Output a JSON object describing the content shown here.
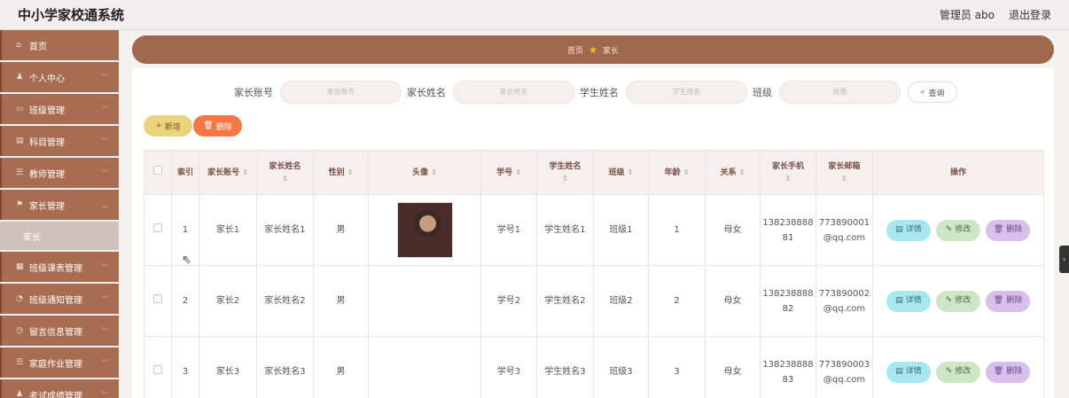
{
  "header": {
    "title": "中小学家校通系统",
    "admin": "管理员 abo",
    "logout": "退出登录"
  },
  "sidebar": {
    "items": [
      {
        "label": "首页",
        "icon": "home-icon",
        "glyph": "⌂"
      },
      {
        "label": "个人中心",
        "icon": "user-icon",
        "glyph": "♟"
      },
      {
        "label": "班级管理",
        "icon": "class-icon",
        "glyph": "▭"
      },
      {
        "label": "科目管理",
        "icon": "subject-icon",
        "glyph": "▤"
      },
      {
        "label": "教师管理",
        "icon": "teacher-icon",
        "glyph": "☰"
      },
      {
        "label": "家长管理",
        "icon": "parent-icon",
        "glyph": "⚑"
      },
      {
        "label": "班级课表管理",
        "icon": "schedule-icon",
        "glyph": "▦"
      },
      {
        "label": "班级通知管理",
        "icon": "notice-icon",
        "glyph": "◔"
      },
      {
        "label": "留言信息管理",
        "icon": "message-icon",
        "glyph": "◷"
      },
      {
        "label": "家庭作业管理",
        "icon": "homework-icon",
        "glyph": "☰"
      },
      {
        "label": "考试成绩管理",
        "icon": "exam-icon",
        "glyph": "♟"
      }
    ],
    "sub_active": "家长"
  },
  "breadcrumb": {
    "home": "首页",
    "current": "家长"
  },
  "search": {
    "fields": [
      {
        "label": "家长账号",
        "placeholder": "家长账号"
      },
      {
        "label": "家长姓名",
        "placeholder": "家长姓名"
      },
      {
        "label": "学生姓名",
        "placeholder": "学生姓名"
      },
      {
        "label": "班级",
        "placeholder": "班级"
      }
    ],
    "query_label": "查询"
  },
  "actions": {
    "add": "新增",
    "delete": "删除"
  },
  "table": {
    "headers": {
      "index": "索引",
      "account": "家长账号",
      "name": "家长姓名",
      "gender": "性别",
      "avatar": "头像",
      "student_no": "学号",
      "student_name": "学生姓名",
      "class": "班级",
      "age": "年龄",
      "relation": "关系",
      "phone": "家长手机",
      "email": "家长邮箱",
      "ops": "操作"
    },
    "rows": [
      {
        "index": "1",
        "account": "家长1",
        "name": "家长姓名1",
        "gender": "男",
        "has_avatar": true,
        "student_no": "学号1",
        "student_name": "学生姓名1",
        "class": "班级1",
        "age": "1",
        "relation": "母女",
        "phone_a": "138238888",
        "phone_b": "81",
        "email_a": "773890001",
        "email_b": "@qq.com"
      },
      {
        "index": "2",
        "account": "家长2",
        "name": "家长姓名2",
        "gender": "男",
        "has_avatar": false,
        "student_no": "学号2",
        "student_name": "学生姓名2",
        "class": "班级2",
        "age": "2",
        "relation": "母女",
        "phone_a": "138238888",
        "phone_b": "82",
        "email_a": "773890002",
        "email_b": "@qq.com"
      },
      {
        "index": "3",
        "account": "家长3",
        "name": "家长姓名3",
        "gender": "男",
        "has_avatar": false,
        "student_no": "学号3",
        "student_name": "学生姓名3",
        "class": "班级3",
        "age": "3",
        "relation": "母女",
        "phone_a": "138238888",
        "phone_b": "83",
        "email_a": "773890003",
        "email_b": "@qq.com"
      }
    ],
    "row_ops": {
      "detail": "详情",
      "edit": "修改",
      "delete": "删除"
    }
  },
  "colors": {
    "brand": "#a86c50",
    "breadcrumb": "#a0694f",
    "add": "#ebd37e",
    "delete": "#f47744"
  }
}
